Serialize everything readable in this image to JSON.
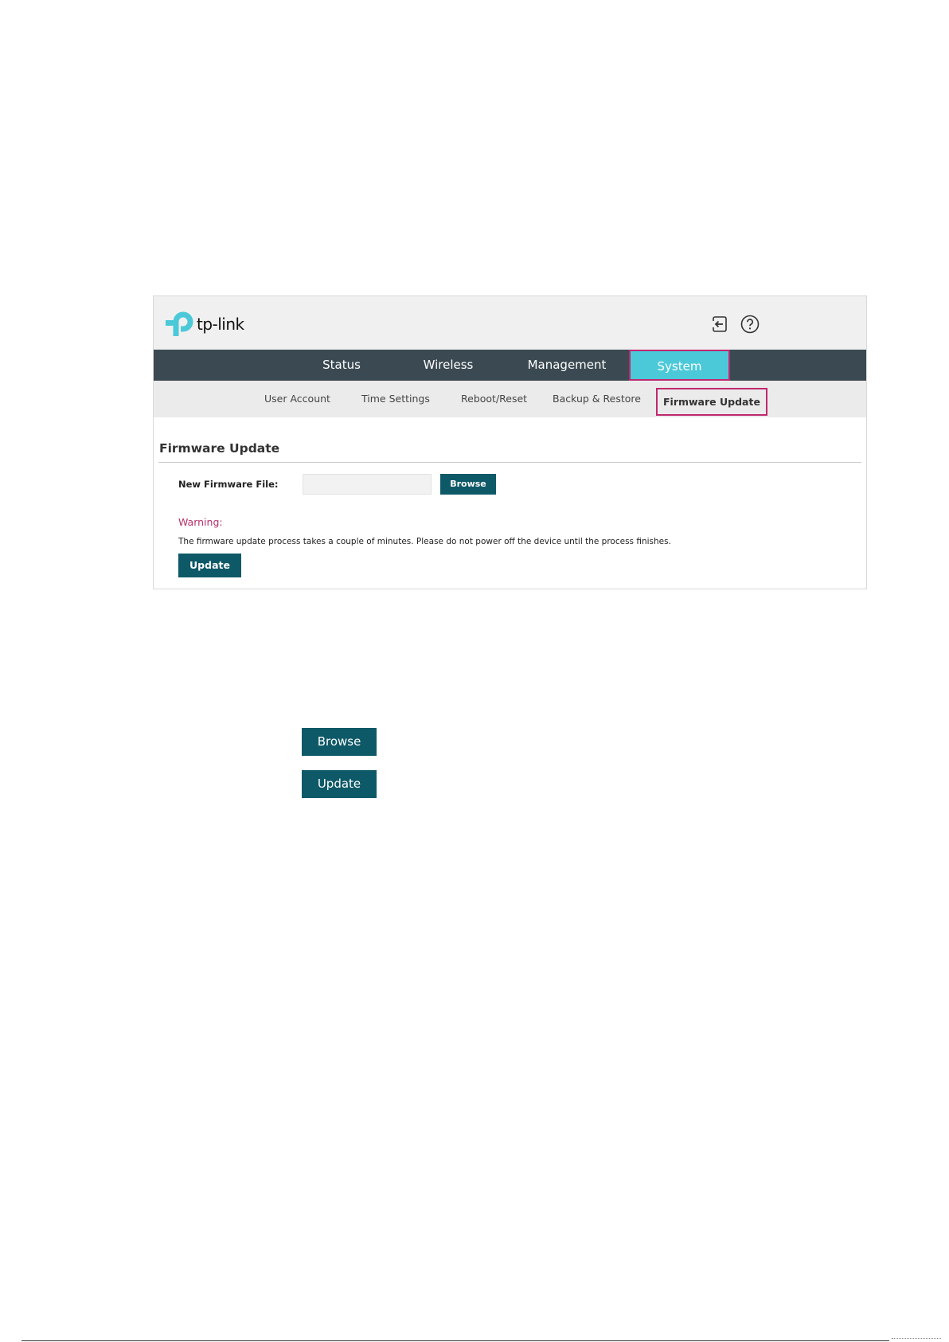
{
  "brand": {
    "logo_text": "tp-link"
  },
  "header_icons": [
    "logout-icon",
    "help-icon"
  ],
  "main_nav": {
    "status": "Status",
    "wireless": "Wireless",
    "management": "Management",
    "system": "System"
  },
  "sub_nav": {
    "user_account": "User Account",
    "time_settings": "Time Settings",
    "reboot_reset": "Reboot/Reset",
    "backup_restore": "Backup & Restore",
    "firmware_update": "Firmware Update"
  },
  "content": {
    "section_title": "Firmware Update",
    "file_label": "New Firmware File:",
    "file_value": "",
    "browse_label": "Browse",
    "warning_label": "Warning:",
    "warning_text": "The firmware update process takes a couple of minutes. Please do not power off the device until the process finishes.",
    "update_label": "Update"
  },
  "standalone_buttons": {
    "browse": "Browse",
    "update": "Update"
  },
  "colors": {
    "nav_bg": "#3b4a52",
    "active_tab": "#4bc9d9",
    "highlight_border": "#c0286e",
    "button": "#0e5967",
    "warning": "#b5306a"
  }
}
